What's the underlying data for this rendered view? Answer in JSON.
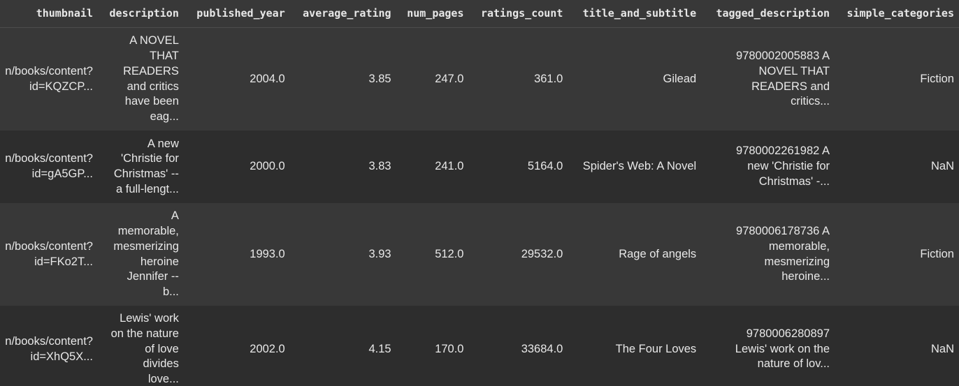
{
  "columns": [
    "thumbnail",
    "description",
    "published_year",
    "average_rating",
    "num_pages",
    "ratings_count",
    "title_and_subtitle",
    "tagged_description",
    "simple_categories"
  ],
  "rows": [
    {
      "thumbnail": [
        "n/books/content?",
        "id=KQZCP..."
      ],
      "description": [
        "A NOVEL",
        "THAT",
        "READERS",
        "and critics",
        "have been",
        "eag..."
      ],
      "published_year": "2004.0",
      "average_rating": "3.85",
      "num_pages": "247.0",
      "ratings_count": "361.0",
      "title_and_subtitle": "Gilead",
      "tagged_description": [
        "9780002005883 A",
        "NOVEL THAT",
        "READERS and",
        "critics..."
      ],
      "simple_categories": "Fiction"
    },
    {
      "thumbnail": [
        "n/books/content?",
        "id=gA5GP..."
      ],
      "description": [
        "A new",
        "'Christie for",
        "Christmas' --",
        "a full-lengt..."
      ],
      "published_year": "2000.0",
      "average_rating": "3.83",
      "num_pages": "241.0",
      "ratings_count": "5164.0",
      "title_and_subtitle": "Spider's Web: A Novel",
      "tagged_description": [
        "9780002261982 A",
        "new 'Christie for",
        "Christmas' -..."
      ],
      "simple_categories": "NaN"
    },
    {
      "thumbnail": [
        "n/books/content?",
        "id=FKo2T..."
      ],
      "description": [
        "A",
        "memorable,",
        "mesmerizing",
        "heroine",
        "Jennifer --",
        "b..."
      ],
      "published_year": "1993.0",
      "average_rating": "3.93",
      "num_pages": "512.0",
      "ratings_count": "29532.0",
      "title_and_subtitle": "Rage of angels",
      "tagged_description": [
        "9780006178736 A",
        "memorable,",
        "mesmerizing",
        "heroine..."
      ],
      "simple_categories": "Fiction"
    },
    {
      "thumbnail": [
        "n/books/content?",
        "id=XhQ5X..."
      ],
      "description": [
        "Lewis' work",
        "on the nature",
        "of love",
        "divides",
        "love..."
      ],
      "published_year": "2002.0",
      "average_rating": "4.15",
      "num_pages": "170.0",
      "ratings_count": "33684.0",
      "title_and_subtitle": "The Four Loves",
      "tagged_description": [
        "9780006280897",
        "Lewis' work on the",
        "nature of lov..."
      ],
      "simple_categories": "NaN"
    }
  ]
}
